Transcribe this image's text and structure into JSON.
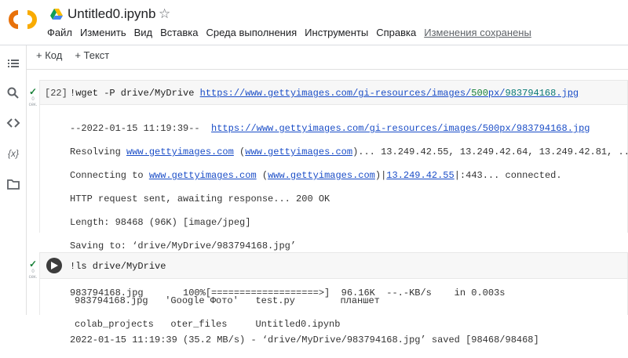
{
  "app": {
    "filename": "Untitled0.ipynb"
  },
  "menu": [
    "Файл",
    "Изменить",
    "Вид",
    "Вставка",
    "Среда выполнения",
    "Инструменты",
    "Справка"
  ],
  "saved_status": "Изменения сохранены",
  "toolbar": {
    "add_code": "+ Код",
    "add_text": "+ Текст"
  },
  "sidebar": {
    "variables_label": "{x}"
  },
  "cell1": {
    "exec_count": "[22]",
    "gutter_counter": "0",
    "gutter_unit": "сек.",
    "code_prefix": "!wget -P drive/MyDrive ",
    "url_a": "https://www.gettyimages.com/gi-resources/images/",
    "url_b": "500",
    "url_c": "px/",
    "url_d": "983794168",
    "url_e": ".jpg",
    "output": {
      "l1_prefix": "--2022-01-15 11:19:39--  ",
      "l1_link": "https://www.gettyimages.com/gi-resources/images/500px/983794168.jpg",
      "l2_prefix": "Resolving ",
      "l2_link1": "www.gettyimages.com",
      "l2_mid": " (",
      "l2_link2": "www.gettyimages.com",
      "l2_suffix": ")... 13.249.42.55, 13.249.42.64, 13.249.42.81, ...",
      "l3_prefix": "Connecting to ",
      "l3_link1": "www.gettyimages.com",
      "l3_mid": " (",
      "l3_link2": "www.gettyimages.com",
      "l3_bar": ")|",
      "l3_link3": "13.249.42.55",
      "l3_port": "|:443",
      "l3_suffix": "... connected.",
      "l4": "HTTP request sent, awaiting response... 200 OK",
      "l5": "Length: 98468 (96K) [image/jpeg]",
      "l6": "Saving to: ‘drive/MyDrive/983794168.jpg’",
      "l7": "983794168.jpg       100%[===================>]  96.16K  --.-KB/s    in 0.003s",
      "l8": "2022-01-15 11:19:39 (35.2 MB/s) - ‘drive/MyDrive/983794168.jpg’ saved [98468/98468]"
    }
  },
  "cell2": {
    "gutter_counter": "0",
    "gutter_unit": "сек.",
    "code": "!ls drive/MyDrive",
    "output": {
      "row1": "983794168.jpg   'Google Фото'   test.py        планшет",
      "row2": "colab_projects   oter_files     Untitled0.ipynb"
    }
  }
}
